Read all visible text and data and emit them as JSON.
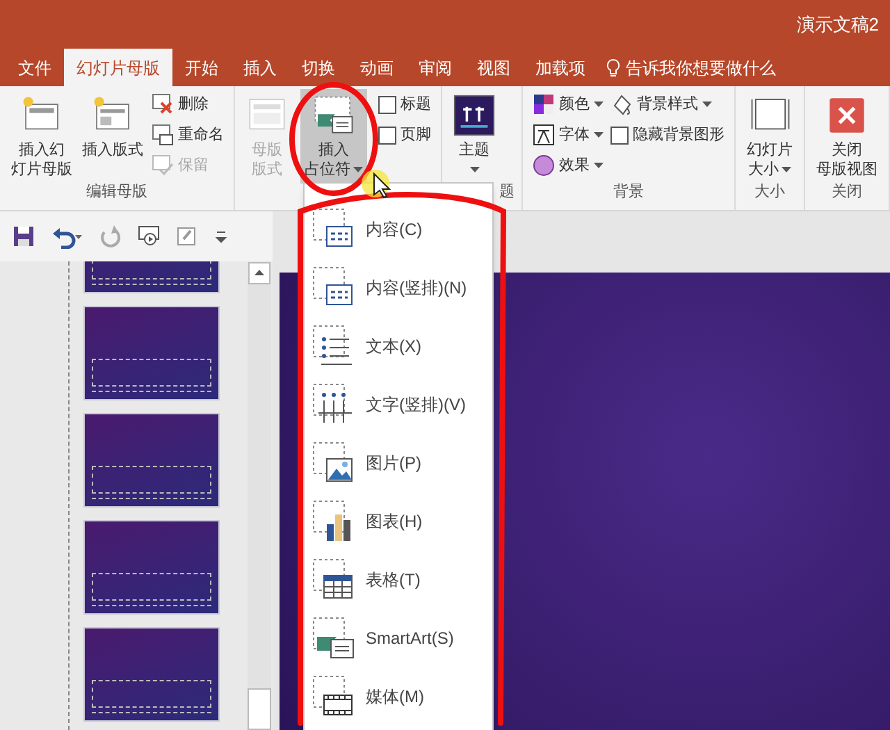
{
  "window": {
    "title": "演示文稿2"
  },
  "tabs": [
    {
      "label": "文件",
      "selected": false
    },
    {
      "label": "幻灯片母版",
      "selected": true
    },
    {
      "label": "开始",
      "selected": false
    },
    {
      "label": "插入",
      "selected": false
    },
    {
      "label": "切换",
      "selected": false
    },
    {
      "label": "动画",
      "selected": false
    },
    {
      "label": "审阅",
      "selected": false
    },
    {
      "label": "视图",
      "selected": false
    },
    {
      "label": "加载项",
      "selected": false
    }
  ],
  "tell_me": {
    "text": "告诉我你想要做什么"
  },
  "ribbon": {
    "groups": [
      {
        "label": "编辑母版",
        "columns": [
          [
            {
              "kind": "large",
              "lines": [
                "插入幻",
                "灯片母版"
              ],
              "disabled": false,
              "pressed": false
            }
          ],
          [
            {
              "kind": "large",
              "lines": [
                "插入版式"
              ],
              "disabled": false,
              "pressed": false
            }
          ],
          [
            {
              "kind": "small",
              "label": "删除",
              "disabled": false
            },
            {
              "kind": "small",
              "label": "重命名",
              "disabled": false
            },
            {
              "kind": "small",
              "label": "保留",
              "disabled": true
            }
          ]
        ]
      },
      {
        "columns": [
          [
            {
              "kind": "large",
              "lines": [
                "母版",
                "版式"
              ],
              "disabled": true,
              "pressed": false
            }
          ],
          [
            {
              "kind": "large",
              "lines": [
                "插入",
                "占位符"
              ],
              "dropdown": true,
              "disabled": false,
              "pressed": true
            }
          ],
          [
            {
              "kind": "checkbox",
              "label": "标题",
              "checked": false,
              "disabled": false
            },
            {
              "kind": "checkbox",
              "label": "页脚",
              "checked": false,
              "disabled": false
            }
          ]
        ]
      },
      {
        "label": "题",
        "columns": [
          [
            {
              "kind": "large",
              "lines": [
                "主题"
              ],
              "dropdown": true,
              "disabled": false,
              "pressed": false
            }
          ]
        ]
      },
      {
        "label": "背景",
        "columns": [
          [
            {
              "kind": "small",
              "label": "颜色",
              "dropdown": true,
              "disabled": false
            },
            {
              "kind": "small",
              "label": "字体",
              "dropdown": true,
              "disabled": false
            },
            {
              "kind": "small",
              "label": "效果",
              "dropdown": true,
              "disabled": false
            }
          ],
          [
            {
              "kind": "small",
              "label": "背景样式",
              "dropdown": true,
              "disabled": false
            },
            {
              "kind": "checkbox",
              "label": "隐藏背景图形",
              "checked": false,
              "disabled": false
            }
          ]
        ]
      },
      {
        "label": "大小",
        "columns": [
          [
            {
              "kind": "large",
              "lines": [
                "幻灯片",
                "大小"
              ],
              "dropdown": true,
              "disabled": false,
              "pressed": false
            }
          ]
        ]
      },
      {
        "label": "关闭",
        "columns": [
          [
            {
              "kind": "large",
              "lines": [
                "关闭",
                "母版视图"
              ],
              "disabled": false,
              "pressed": false
            }
          ]
        ]
      }
    ]
  },
  "placeholder_menu": {
    "items": [
      {
        "label": "内容(C)"
      },
      {
        "label": "内容(竖排)(N)"
      },
      {
        "label": "文本(X)"
      },
      {
        "label": "文字(竖排)(V)"
      },
      {
        "label": "图片(P)"
      },
      {
        "label": "图表(H)"
      },
      {
        "label": "表格(T)"
      },
      {
        "label": "SmartArt(S)"
      },
      {
        "label": "媒体(M)"
      }
    ]
  }
}
